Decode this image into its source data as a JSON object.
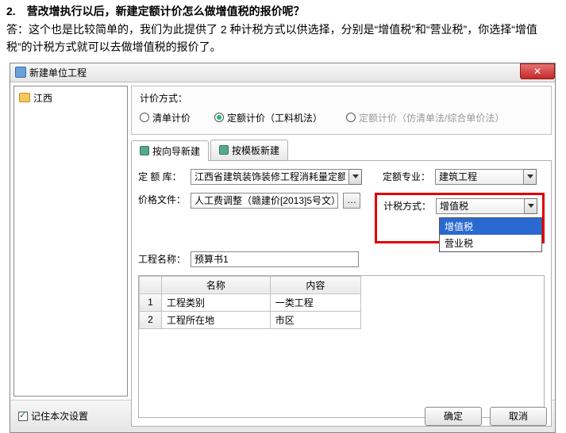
{
  "doc": {
    "question": "2.　营改增执行以后，新建定额计价怎么做增值税的报价呢？",
    "answer": "答：这个也是比较简单的，我们为此提供了 2 种计税方式以供选择，分别是“增值税”和“营业税”，你选择“增值税”的计税方式就可以去做增值税的报价了。"
  },
  "dialog": {
    "title": "新建单位工程"
  },
  "tree": {
    "root": "江西"
  },
  "pricing": {
    "label": "计价方式：",
    "opt1": "清单计价",
    "opt2": "定额计价（工料机法）",
    "opt3": "定额计价（仿清单法/综合单价法）"
  },
  "tabs": {
    "t1": "按向导新建",
    "t2": "按模板新建"
  },
  "form": {
    "lib_label": "定 额 库：",
    "lib_value": "江西省建筑装饰装修工程消耗量定额及统",
    "spec_label": "定额专业：",
    "spec_value": "建筑工程",
    "price_label": "价格文件：",
    "price_value": "人工费调整（赣建价[2013]5号文）",
    "tax_label": "计税方式：",
    "tax_value": "增值税",
    "tax_opt_hl": "增值税",
    "tax_opt2": "营业税",
    "proj_label": "工程名称：",
    "proj_value": "预算书1"
  },
  "table": {
    "h1": "名称",
    "h2": "内容",
    "r1c1": "工程类别",
    "r1c2": "一类工程",
    "r2c1": "工程所在地",
    "r2c2": "市区",
    "n1": "1",
    "n2": "2"
  },
  "footer": {
    "remember": "记住本次设置",
    "ok": "确定",
    "cancel": "取消"
  }
}
